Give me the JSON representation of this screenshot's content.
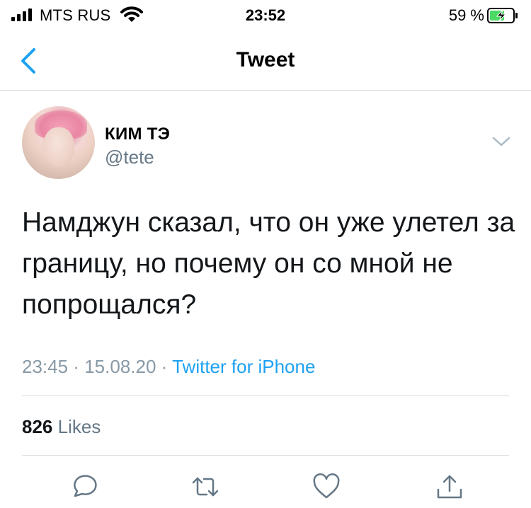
{
  "status_bar": {
    "carrier": "MTS RUS",
    "time": "23:52",
    "battery_percent": "59 %"
  },
  "nav": {
    "title": "Tweet"
  },
  "tweet": {
    "display_name": "КИМ ТЭ",
    "handle": "@tete",
    "text": "Намджун сказал, что он уже улетел за границу, но почему он со мной не попрощался?",
    "time": "23:45",
    "date": "15.08.20",
    "separator": "·",
    "source": "Twitter for iPhone",
    "likes_count": "826",
    "likes_label": "Likes"
  },
  "colors": {
    "accent": "#1da1f2",
    "secondary_text": "#657786",
    "divider": "#d6dde2"
  },
  "icons": {
    "back": "chevron-left-icon",
    "caret": "chevron-down-icon",
    "reply": "reply-icon",
    "retweet": "retweet-icon",
    "like": "heart-icon",
    "share": "share-icon"
  }
}
